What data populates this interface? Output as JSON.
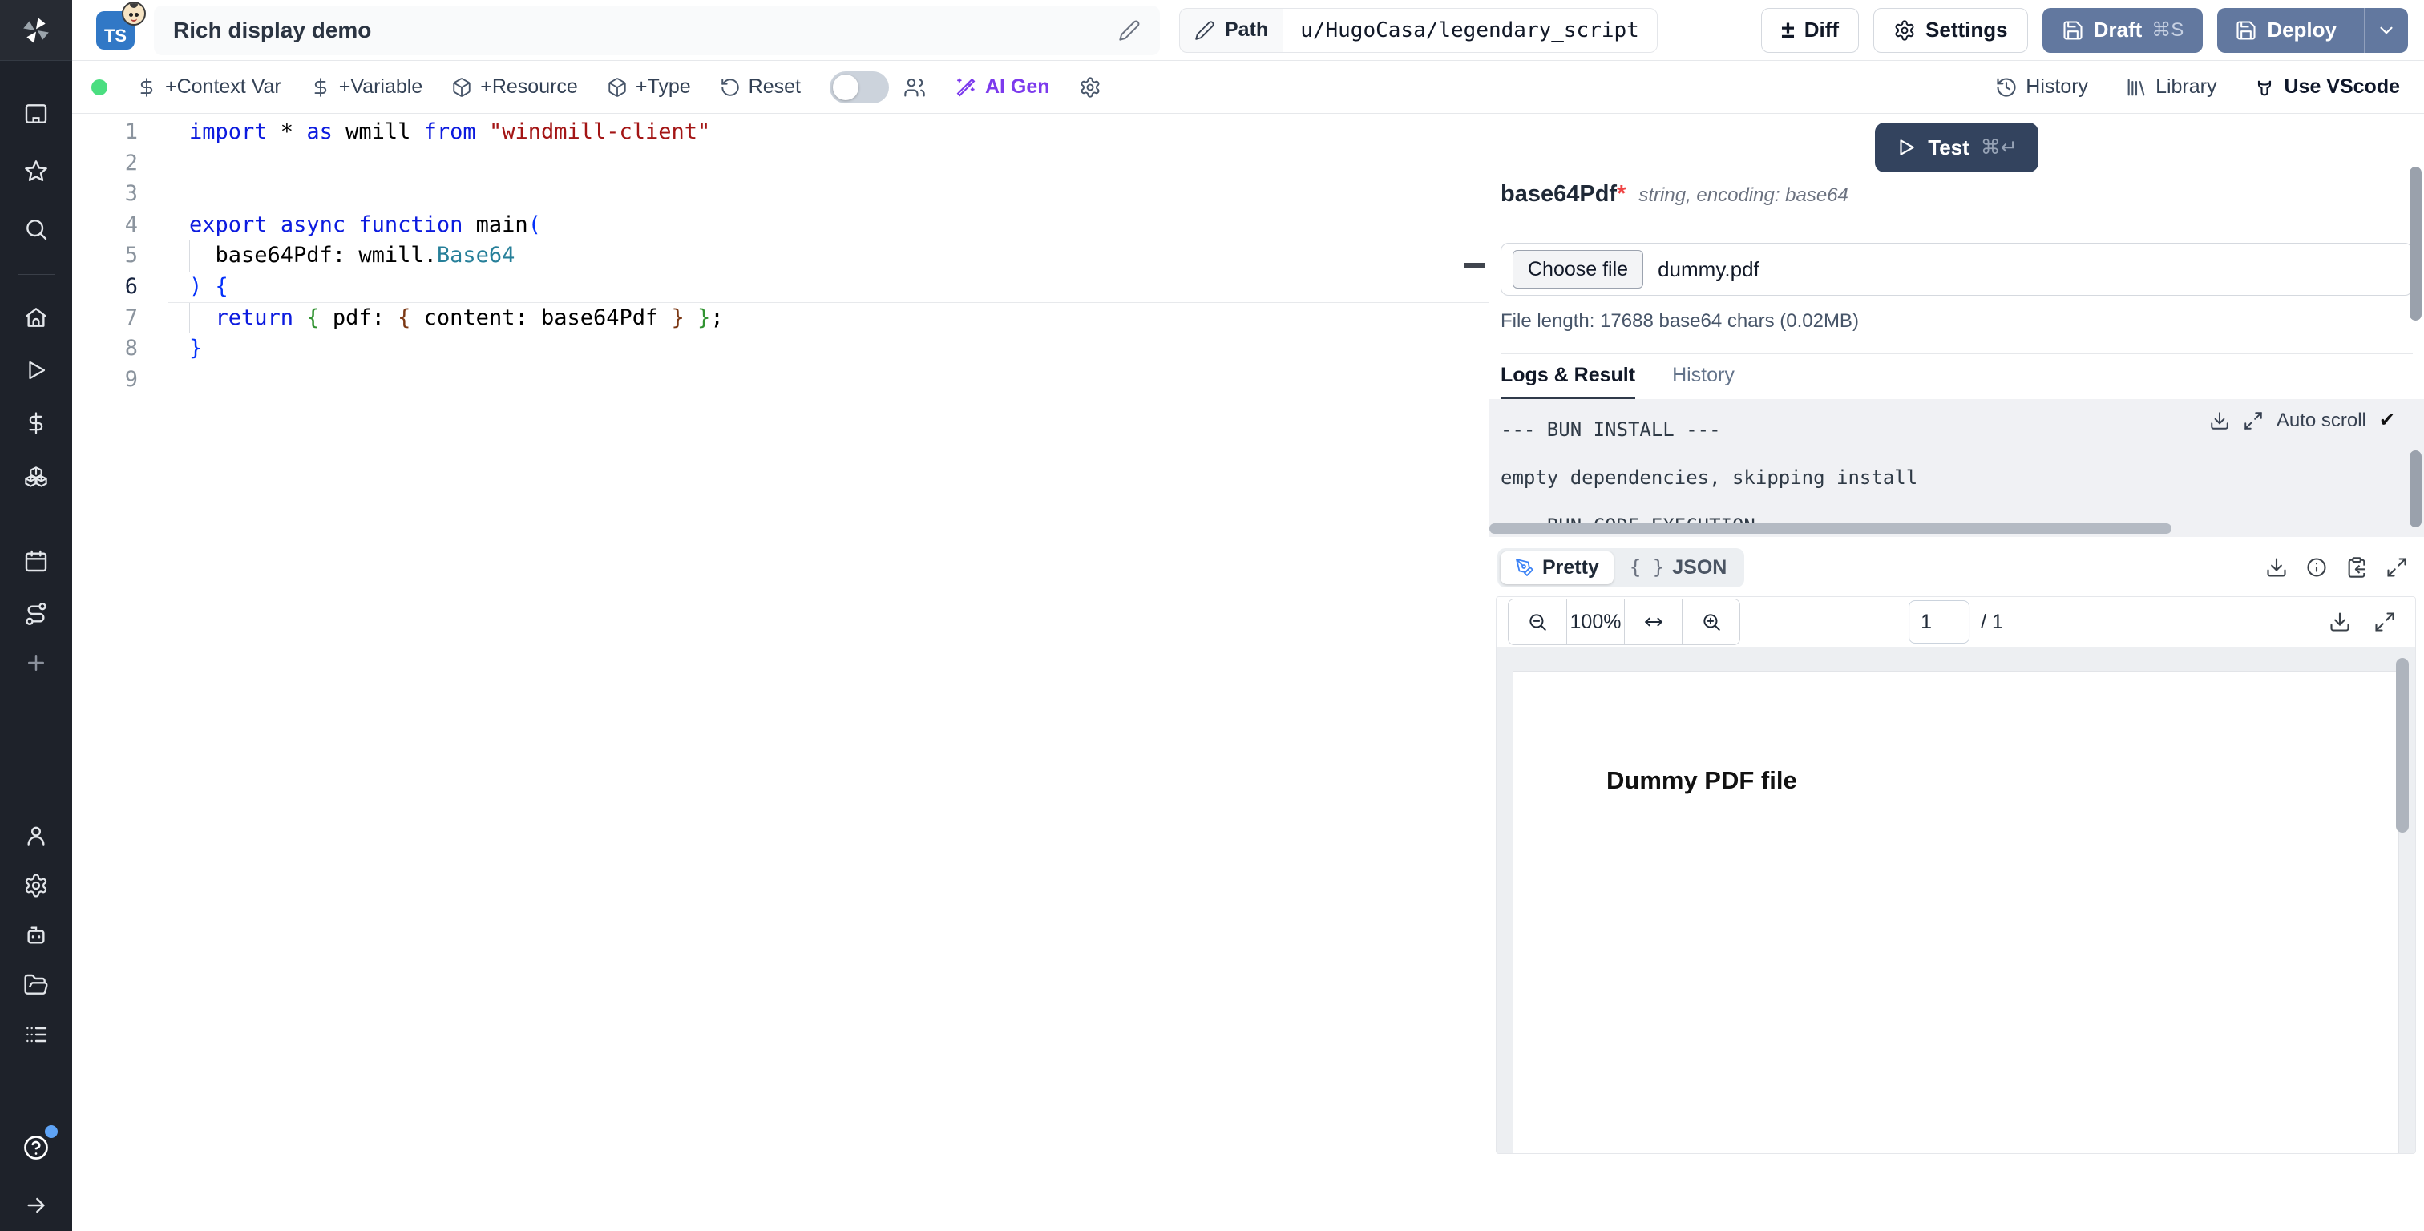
{
  "colors": {
    "accent_slate": "#62789f",
    "navy": "#33435e",
    "ai_purple": "#7c3aed",
    "status_green": "#4ade80",
    "required_red": "#ef4444",
    "ts_blue": "#3178c6"
  },
  "sidebar": {
    "icons": [
      "windmill-logo",
      "workspace",
      "favorites-star",
      "search",
      "home",
      "runs-play",
      "variables-dollar",
      "resources-boxes",
      "schedules-calendar",
      "flows-route",
      "add-plus",
      "user",
      "settings-gear",
      "workers-robot",
      "folders",
      "audit-list",
      "help",
      "expand-arrow"
    ]
  },
  "header": {
    "script_type": "TS",
    "title": "Rich display demo",
    "path_label": "Path",
    "path_value": "u/HugoCasa/legendary_script",
    "diff_label": "Diff",
    "settings_label": "Settings",
    "draft_label": "Draft",
    "draft_kbd": "⌘S",
    "deploy_label": "Deploy"
  },
  "toolbar": {
    "context_var": "+Context Var",
    "variable": "+Variable",
    "resource": "+Resource",
    "type": "+Type",
    "reset": "Reset",
    "ai_gen": "AI Gen",
    "history": "History",
    "library": "Library",
    "use_vscode": "Use VScode"
  },
  "editor": {
    "active_line": 6,
    "lines": [
      {
        "n": "1",
        "tokens": [
          [
            "kw",
            "import"
          ],
          [
            "tx",
            " * "
          ],
          [
            "kw",
            "as"
          ],
          [
            "tx",
            " wmill "
          ],
          [
            "kw",
            "from"
          ],
          [
            "tx",
            " "
          ],
          [
            "str",
            "\"windmill-client\""
          ]
        ]
      },
      {
        "n": "2",
        "tokens": []
      },
      {
        "n": "3",
        "tokens": []
      },
      {
        "n": "4",
        "tokens": [
          [
            "kw",
            "export"
          ],
          [
            "tx",
            " "
          ],
          [
            "kw",
            "async"
          ],
          [
            "tx",
            " "
          ],
          [
            "kw",
            "function"
          ],
          [
            "tx",
            " main"
          ],
          [
            "b1",
            "("
          ]
        ]
      },
      {
        "n": "5",
        "guide": true,
        "tokens": [
          [
            "tx",
            "  base64Pdf: wmill."
          ],
          [
            "ty",
            "Base64"
          ]
        ]
      },
      {
        "n": "6",
        "active": true,
        "tokens": [
          [
            "b1",
            ") {"
          ]
        ]
      },
      {
        "n": "7",
        "guide": true,
        "tokens": [
          [
            "tx",
            "  "
          ],
          [
            "kw",
            "return"
          ],
          [
            "tx",
            " "
          ],
          [
            "b2",
            "{"
          ],
          [
            "tx",
            " pdf: "
          ],
          [
            "b3",
            "{"
          ],
          [
            "tx",
            " content: base64Pdf "
          ],
          [
            "b3",
            "}"
          ],
          [
            "tx",
            " "
          ],
          [
            "b2",
            "}"
          ],
          [
            "tx",
            ";"
          ]
        ]
      },
      {
        "n": "8",
        "tokens": [
          [
            "b1",
            "}"
          ]
        ]
      },
      {
        "n": "9",
        "tokens": []
      }
    ]
  },
  "panel": {
    "test_label": "Test",
    "test_kbd": "⌘↵",
    "arg": {
      "name": "base64Pdf",
      "required_mark": "*",
      "type_note": "string, encoding: base64"
    },
    "file_input": {
      "button": "Choose file",
      "value": "dummy.pdf"
    },
    "file_length": "File length: 17688 base64 chars (0.02MB)",
    "tabs": {
      "logs": "Logs & Result",
      "history": "History"
    },
    "auto_scroll": "Auto scroll",
    "auto_scroll_check": "✔",
    "logs": [
      "--- BUN INSTALL ---",
      "empty dependencies, skipping install",
      "--- BUN CODE EXECUTION ---"
    ],
    "result_tabs": {
      "pretty": "Pretty",
      "json": "JSON",
      "json_braces": "{ }"
    },
    "pdf": {
      "zoom_level": "100%",
      "page": "1",
      "page_total": "/ 1",
      "content_text": "Dummy PDF file"
    }
  }
}
